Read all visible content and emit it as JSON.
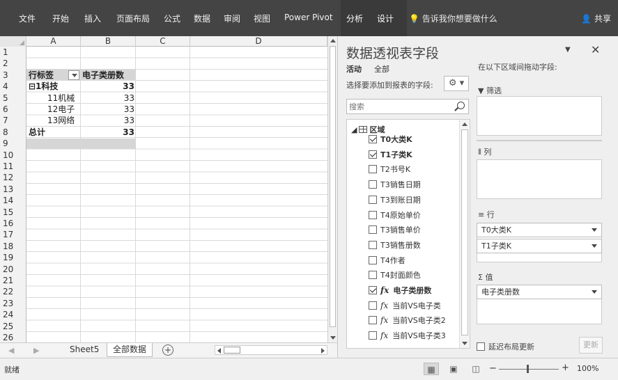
{
  "ribbon": {
    "tabs": [
      "文件",
      "开始",
      "插入",
      "页面布局",
      "公式",
      "数据",
      "审阅",
      "视图",
      "Power Pivot"
    ],
    "context_tabs": [
      "分析",
      "设计"
    ],
    "tell_me": "告诉我你想要做什么",
    "share": "共享"
  },
  "sheet": {
    "columns": [
      "A",
      "B",
      "C",
      "D"
    ],
    "rows": [
      "1",
      "2",
      "3",
      "4",
      "5",
      "6",
      "7",
      "8",
      "9",
      "10",
      "11",
      "12",
      "13",
      "14",
      "15",
      "16",
      "17",
      "18",
      "19",
      "20",
      "21",
      "22",
      "23",
      "24",
      "25",
      "26"
    ],
    "pivot": {
      "header_label": "行标签",
      "header_value": "电子类册数",
      "group_label": "⊟1科技",
      "group_value": "33",
      "items": [
        {
          "label": "11机械",
          "value": "33"
        },
        {
          "label": "12电子",
          "value": "33"
        },
        {
          "label": "13网络",
          "value": "33"
        }
      ],
      "total_label": "总计",
      "total_value": "33"
    }
  },
  "sheet_tabs": {
    "tabs": [
      "Sheet5",
      "全部数据"
    ],
    "add": "+"
  },
  "pane": {
    "title": "数据透视表字段",
    "tabs": [
      "活动",
      "全部"
    ],
    "choose_label": "选择要添加到报表的字段:",
    "search_placeholder": "搜索",
    "table_name": "区域",
    "fields": [
      {
        "name": "T0大类K",
        "checked": true,
        "formula": false
      },
      {
        "name": "T1子类K",
        "checked": true,
        "formula": false
      },
      {
        "name": "T2书号K",
        "checked": false,
        "formula": false
      },
      {
        "name": "T3销售日期",
        "checked": false,
        "formula": false
      },
      {
        "name": "T3到账日期",
        "checked": false,
        "formula": false
      },
      {
        "name": "T4原始单价",
        "checked": false,
        "formula": false
      },
      {
        "name": "T3销售单价",
        "checked": false,
        "formula": false
      },
      {
        "name": "T3销售册数",
        "checked": false,
        "formula": false
      },
      {
        "name": "T4作者",
        "checked": false,
        "formula": false
      },
      {
        "name": "T4封面颜色",
        "checked": false,
        "formula": false
      },
      {
        "name": "电子类册数",
        "checked": true,
        "formula": true
      },
      {
        "name": "当前VS电子类",
        "checked": false,
        "formula": true
      },
      {
        "name": "当前VS电子类2",
        "checked": false,
        "formula": true
      },
      {
        "name": "当前VS电子类3",
        "checked": false,
        "formula": true
      }
    ],
    "areas_label": "在以下区域间拖动字段:",
    "filter_label": "筛选",
    "columns_label": "列",
    "rows_label": "行",
    "values_label": "值",
    "row_fields": [
      "T0大类K",
      "T1子类K"
    ],
    "value_fields": [
      "电子类册数"
    ],
    "defer_label": "延迟布局更新",
    "update_label": "更新"
  },
  "status": {
    "text": "就绪",
    "zoom_minus": "−",
    "zoom_plus": "+",
    "zoom": "100%"
  }
}
